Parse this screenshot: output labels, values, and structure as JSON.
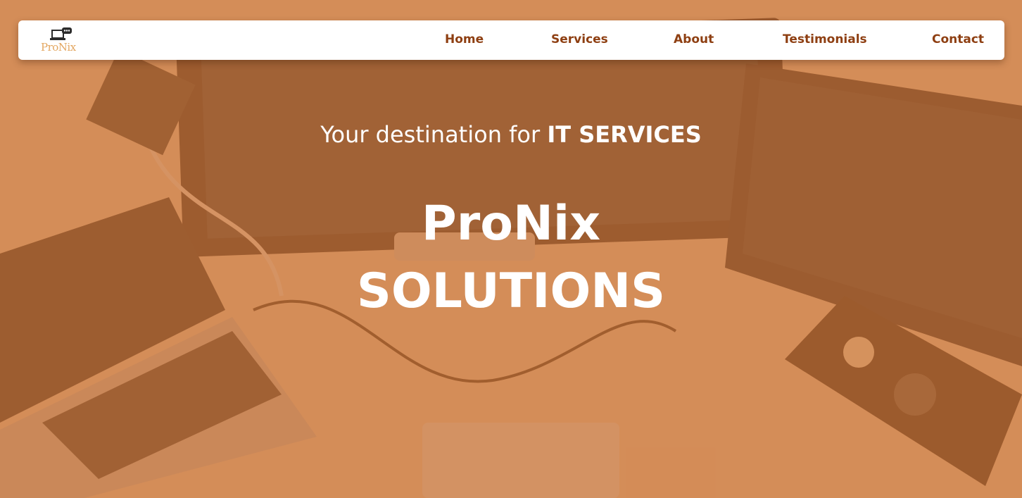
{
  "brand": {
    "logo_text": "ProNix",
    "icon": "laptop-chat-icon"
  },
  "nav": {
    "items": [
      {
        "label": "Home"
      },
      {
        "label": "Services"
      },
      {
        "label": "About"
      },
      {
        "label": "Testimonials"
      },
      {
        "label": "Contact"
      }
    ]
  },
  "hero": {
    "tagline_prefix": "Your destination for ",
    "tagline_strong": "IT SERVICES",
    "title": "ProNix",
    "subtitle": "SOLUTIONS"
  },
  "colors": {
    "overlay": "#c97030",
    "nav_text": "#8e3f12",
    "logo_text": "#e3a761",
    "hero_text": "#ffffff"
  }
}
